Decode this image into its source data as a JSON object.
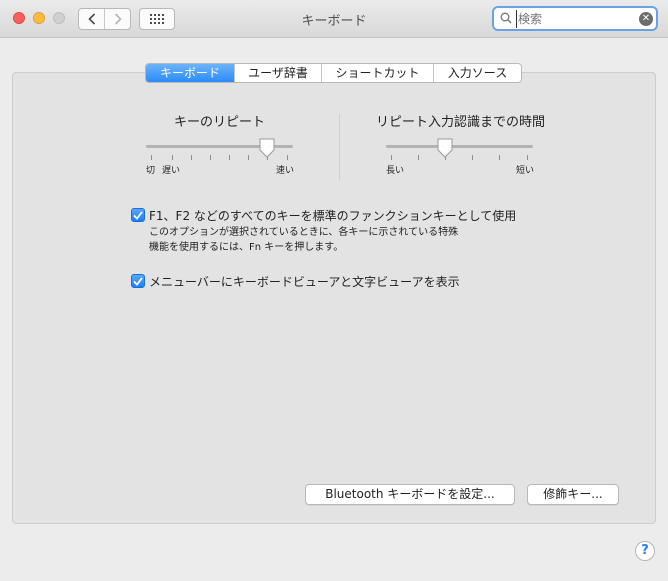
{
  "window": {
    "title": "キーボード"
  },
  "search": {
    "placeholder": "検索",
    "value": ""
  },
  "tabs": [
    {
      "label": "キーボード",
      "active": true
    },
    {
      "label": "ユーザ辞書",
      "active": false
    },
    {
      "label": "ショートカット",
      "active": false
    },
    {
      "label": "入力ソース",
      "active": false
    }
  ],
  "key_repeat": {
    "label": "キーのリピート",
    "min_label": "切",
    "slow_label": "遅い",
    "fast_label": "速い",
    "value_fraction": 0.82
  },
  "delay_until_repeat": {
    "label": "リピート入力認識までの時間",
    "long_label": "長い",
    "short_label": "短い",
    "value_fraction": 0.4
  },
  "options": {
    "fn_keys": {
      "label": "F1、F2 などのすべてのキーを標準のファンクションキーとして使用",
      "checked": true,
      "desc_line1": "このオプションが選択されているときに、各キーに示されている特殊",
      "desc_line2": "機能を使用するには、Fn キーを押します。"
    },
    "show_viewer": {
      "label": "メニューバーにキーボードビューアと文字ビューアを表示",
      "checked": true
    }
  },
  "buttons": {
    "bluetooth": "Bluetooth キーボードを設定...",
    "modifier": "修飾キー..."
  },
  "help": {
    "label": "?"
  },
  "colors": {
    "accent": "#2a8cf7",
    "close": "#fc605c",
    "minimize": "#fdbc40",
    "zoom": "#d0d0d0"
  }
}
